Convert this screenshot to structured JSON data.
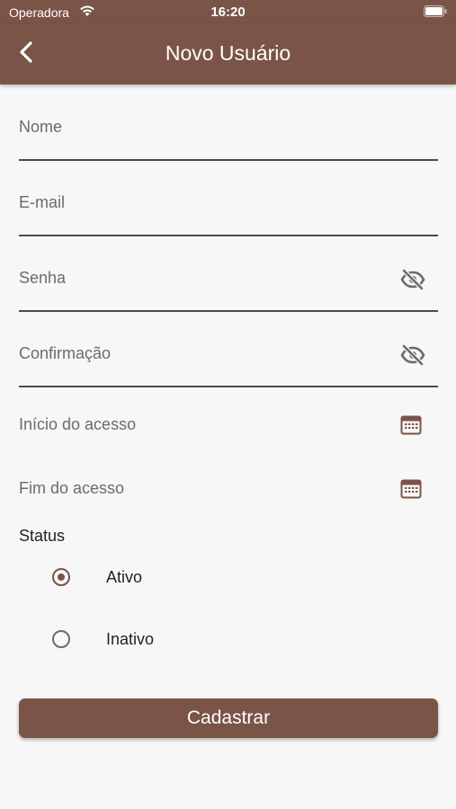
{
  "status_bar": {
    "carrier": "Operadora",
    "time": "16:20",
    "wifi_icon": "wifi-icon",
    "battery_icon": "battery-icon"
  },
  "app_bar": {
    "title": "Novo Usuário",
    "back_icon": "chevron-left-icon",
    "background": "#7a5447"
  },
  "form": {
    "name_label": "Nome",
    "email_label": "E-mail",
    "password_label": "Senha",
    "confirm_label": "Confirmação",
    "start_label": "Início do acesso",
    "end_label": "Fim do acesso",
    "visibility_icon": "eye-off-icon",
    "calendar_icon": "calendar-icon"
  },
  "status": {
    "label": "Status",
    "options": [
      {
        "label": "Ativo",
        "selected": true
      },
      {
        "label": "Inativo",
        "selected": false
      }
    ]
  },
  "submit": {
    "label": "Cadastrar"
  },
  "colors": {
    "accent": "#7a5447",
    "background": "#f7f7f7",
    "underline": "#4a4a4a"
  }
}
